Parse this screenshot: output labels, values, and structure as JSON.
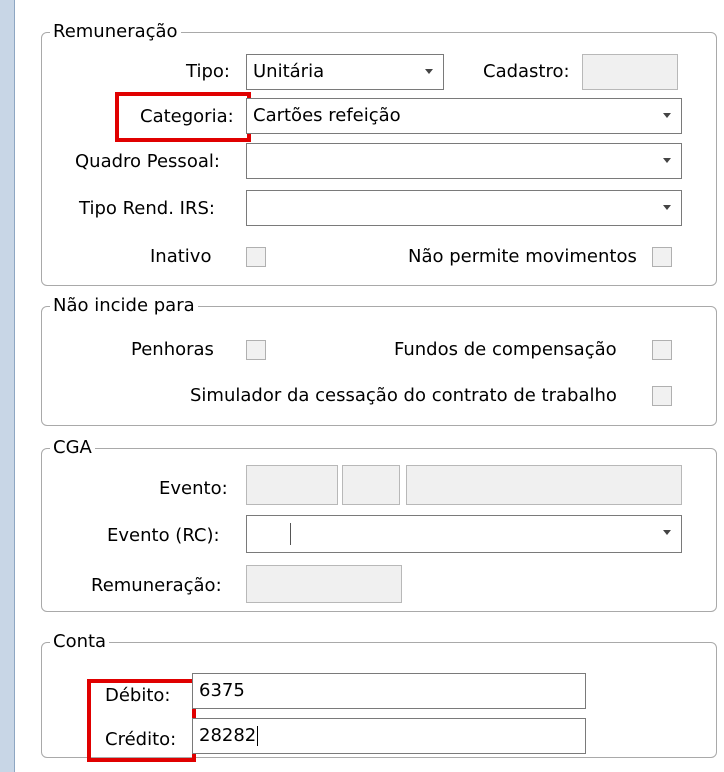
{
  "remuneracao": {
    "legend": "Remuneração",
    "tipo_label": "Tipo:",
    "tipo_value": "Unitária",
    "cadastro_label": "Cadastro:",
    "cadastro_value": "",
    "categoria_label": "Categoria:",
    "categoria_value": "Cartões refeição",
    "quadro_label": "Quadro Pessoal:",
    "quadro_value": "",
    "tipo_rend_label": "Tipo Rend. IRS:",
    "tipo_rend_value": "",
    "inativo_label": "Inativo",
    "nao_permite_label": "Não permite movimentos"
  },
  "nao_incide": {
    "legend": "Não incide para",
    "penhoras_label": "Penhoras",
    "fundos_label": "Fundos de compensação",
    "simulador_label": "Simulador da cessação do contrato de trabalho"
  },
  "cga": {
    "legend": "CGA",
    "evento_label": "Evento:",
    "evento_rc_label": "Evento (RC):",
    "remuneracao_label": "Remuneração:"
  },
  "conta": {
    "legend": "Conta",
    "debito_label": "Débito:",
    "debito_value": "6375",
    "credito_label": "Crédito:",
    "credito_value": "28282"
  },
  "colors": {
    "highlight": "#e00000",
    "border": "#a9a9a9",
    "disabled": "#f0f0f0"
  },
  "icons": {
    "dropdown": "chevron-down-icon",
    "checkbox": "checkbox-unchecked"
  }
}
